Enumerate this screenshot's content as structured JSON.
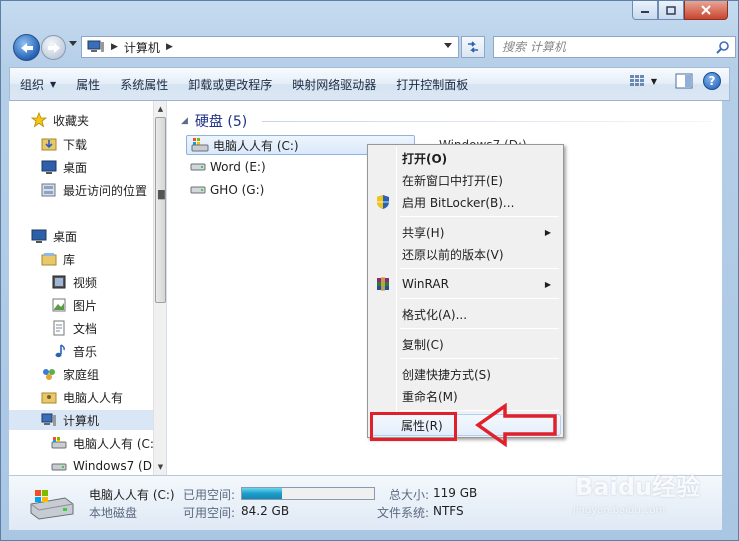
{
  "address": {
    "crumb": "计算机",
    "search_placeholder": "搜索 计算机"
  },
  "toolbar": {
    "items": [
      "组织",
      "属性",
      "系统属性",
      "卸载或更改程序",
      "映射网络驱动器",
      "打开控制面板"
    ],
    "help": "?"
  },
  "sidebar": {
    "items": [
      {
        "label": "收藏夹",
        "icon": "star-icon"
      },
      {
        "label": "下载",
        "icon": "download-folder-icon"
      },
      {
        "label": "桌面",
        "icon": "desktop-icon"
      },
      {
        "label": "最近访问的位置",
        "icon": "recent-places-icon"
      },
      {
        "label": "桌面",
        "icon": "desktop-icon"
      },
      {
        "label": "库",
        "icon": "library-icon"
      },
      {
        "label": "视频",
        "icon": "video-library-icon"
      },
      {
        "label": "图片",
        "icon": "pictures-library-icon"
      },
      {
        "label": "文档",
        "icon": "documents-library-icon"
      },
      {
        "label": "音乐",
        "icon": "music-library-icon"
      },
      {
        "label": "家庭组",
        "icon": "homegroup-icon"
      },
      {
        "label": "电脑人人有",
        "icon": "user-folder-icon"
      },
      {
        "label": "计算机",
        "icon": "computer-icon"
      },
      {
        "label": "电脑人人有 (C:",
        "icon": "system-drive-icon"
      },
      {
        "label": "Windows7 (D:",
        "icon": "drive-icon"
      }
    ]
  },
  "content": {
    "group_title": "硬盘 (5)",
    "drives": [
      "电脑人人有 (C:)",
      "Word (E:)",
      "GHO (G:)"
    ],
    "partial_drive": "Windows7 (D:)"
  },
  "context_menu": {
    "items": [
      {
        "label": "打开(O)",
        "bold": true
      },
      {
        "label": "在新窗口中打开(E)"
      },
      {
        "label": "启用 BitLocker(B)...",
        "icon": "shield-icon"
      },
      {
        "label": "共享(H)",
        "submenu": true
      },
      {
        "label": "还原以前的版本(V)"
      },
      {
        "label": "WinRAR",
        "submenu": true,
        "icon": "winrar-icon"
      },
      {
        "label": "格式化(A)..."
      },
      {
        "label": "复制(C)"
      },
      {
        "label": "创建快捷方式(S)"
      },
      {
        "label": "重命名(M)"
      },
      {
        "label": "属性(R)",
        "highlighted": true
      }
    ]
  },
  "details": {
    "name": "电脑人人有 (C:)",
    "type": "本地磁盘",
    "used_label": "已用空间:",
    "free_label": "可用空间:",
    "free_value": "84.2 GB",
    "total_label": "总大小:",
    "total_value": "119 GB",
    "fs_label": "文件系统:",
    "fs_value": "NTFS",
    "used_fraction": 0.3
  },
  "watermark": {
    "brand": "Baidu经验",
    "url": "jingyan.baidu.com"
  },
  "colors": {
    "annotation_red": "#e0202a"
  }
}
